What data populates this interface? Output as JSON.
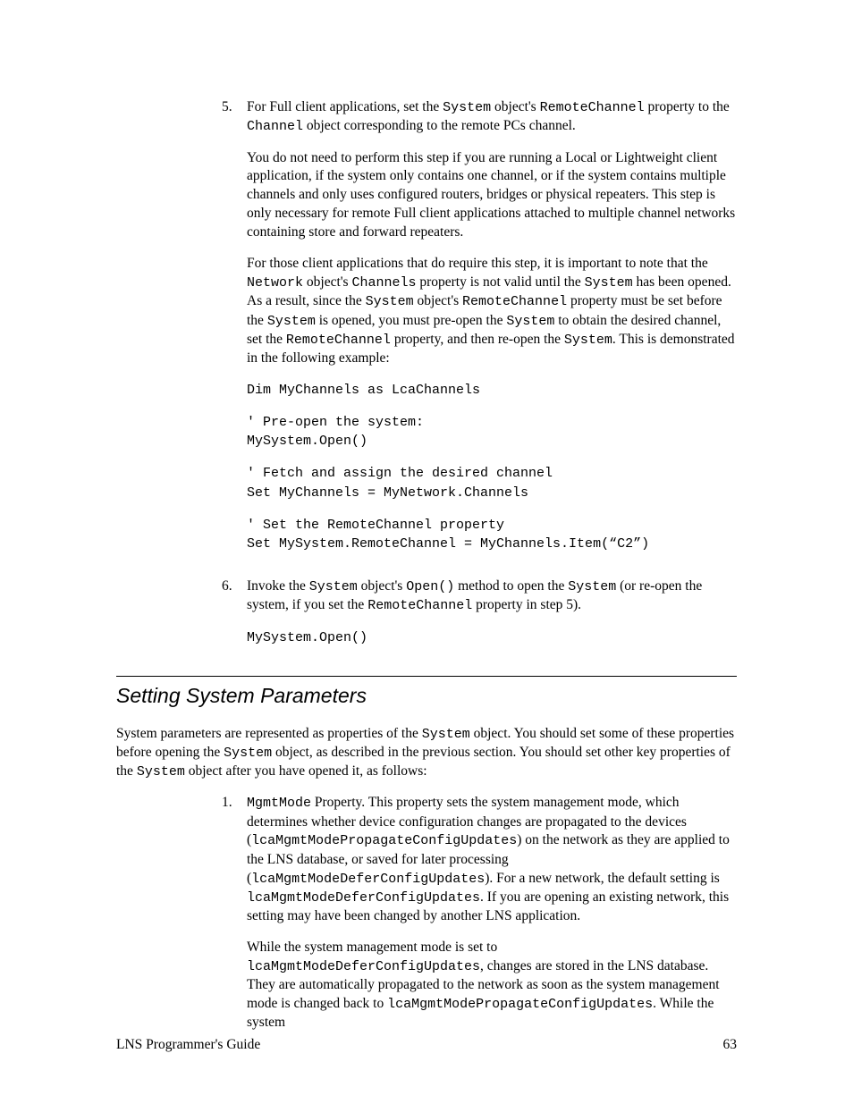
{
  "step5": {
    "num": "5.",
    "p1_a": "For Full client applications, set the ",
    "p1_b": " object's ",
    "p1_c": " property to the ",
    "p1_d": " object corresponding to the remote PCs channel.",
    "code_System": "System",
    "code_RemoteChannel": "RemoteChannel",
    "code_Channel": "Channel",
    "p2": "You do not need to perform this step if you are running a Local or Lightweight client application, if the system only contains one channel, or if the system contains multiple channels and only uses configured routers, bridges or physical repeaters. This step is only necessary for remote Full client applications attached to multiple channel networks containing store and forward repeaters.",
    "p3_a": "For those client applications that do require this step, it is important to note that the ",
    "p3_b": " object's ",
    "p3_c": " property is not valid until the ",
    "p3_d": " has been opened. As a result, since the ",
    "p3_e": " object's ",
    "p3_f": " property must be set before the ",
    "p3_g": " is opened, you must pre-open the ",
    "p3_h": " to obtain the desired channel, set the ",
    "p3_i": " property, and then re-open the ",
    "p3_j": ". This is demonstrated in the following example:",
    "code_Network": "Network",
    "code_Channels": "Channels",
    "codeblock1": "Dim MyChannels as LcaChannels",
    "codeblock2": "' Pre-open the system:\nMySystem.Open()",
    "codeblock3": "' Fetch and assign the desired channel\nSet MyChannels = MyNetwork.Channels",
    "codeblock4": "' Set the RemoteChannel property\nSet MySystem.RemoteChannel = MyChannels.Item(“C2”)"
  },
  "step6": {
    "num": "6.",
    "p1_a": "Invoke the ",
    "p1_b": " object's ",
    "p1_c": " method to open the ",
    "p1_d": " (or re-open the system, if you set the ",
    "p1_e": " property in step 5).",
    "code_System": "System",
    "code_Open": "Open()",
    "code_RemoteChannel": "RemoteChannel",
    "codeblock1": "MySystem.Open()"
  },
  "section": {
    "title": "Setting System Parameters",
    "intro_a": "System parameters are represented as properties of the ",
    "intro_b": " object. You should set some of these properties before opening the ",
    "intro_c": " object, as described in the previous section. You should set other key properties of the ",
    "intro_d": " object after you have opened it, as follows:",
    "code_System": "System"
  },
  "sub1": {
    "num": "1.",
    "p1_a": " Property. This property sets the system management mode, which determines whether device configuration changes are propagated to the devices (",
    "p1_b": ") on the network as they are applied to the LNS database, or saved for later processing (",
    "p1_c": "). For a new network, the default setting is ",
    "p1_d": ". If you are opening an existing network, this setting may have been changed by another LNS application.",
    "code_MgmtMode": "MgmtMode",
    "code_Prop": "lcaMgmtModePropagateConfigUpdates",
    "code_Defer": "lcaMgmtModeDeferConfigUpdates",
    "p2_a": "While the system management mode is set to ",
    "p2_b": ", changes are stored in the LNS database. They are automatically propagated to the network as soon as the system management mode is changed back to ",
    "p2_c": ". While the system"
  },
  "footer": {
    "left": "LNS Programmer's Guide",
    "right": "63"
  }
}
